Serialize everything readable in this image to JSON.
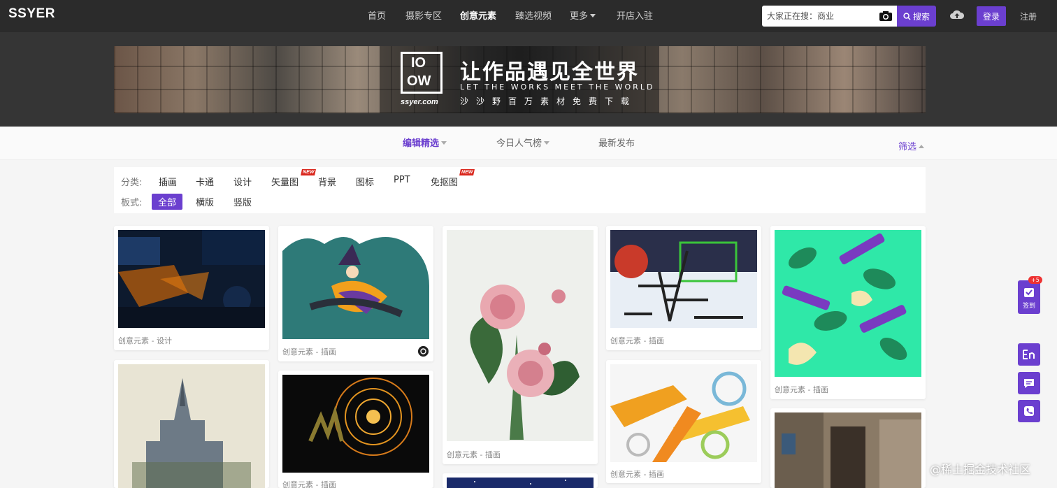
{
  "header": {
    "logo": "SSYER",
    "nav": [
      {
        "label": "首页"
      },
      {
        "label": "摄影专区"
      },
      {
        "label": "创意元素"
      },
      {
        "label": "臻选视频"
      },
      {
        "label": "更多"
      },
      {
        "label": "开店入驻"
      }
    ],
    "active_nav": "创意元素",
    "search_placeholder": "大家正在搜：商业",
    "search_button": "搜索",
    "login": "登录",
    "register": "注册"
  },
  "banner": {
    "logo_top": "IO",
    "logo_bottom": "OW",
    "site": "ssyer.com",
    "title": "让作品遇见全世界",
    "subtitle": "LET THE WORKS MEET THE WORLD",
    "subtitle_cn": "沙沙野百万素材免费下载"
  },
  "sort_tabs": [
    {
      "label": "编辑精选"
    },
    {
      "label": "今日人气榜"
    },
    {
      "label": "最新发布"
    }
  ],
  "filter_toggle": "筛选",
  "filters": {
    "category_label": "分类:",
    "categories": [
      "插画",
      "卡通",
      "设计",
      "矢量图",
      "背景",
      "图标",
      "PPT",
      "免抠图"
    ],
    "new_badge": "NEW",
    "layout_label": "板式:",
    "layouts": [
      "全部",
      "横版",
      "竖版"
    ]
  },
  "cards": [
    {
      "caption": "创意元素 - 设计"
    },
    {
      "caption": "创意元素 - 插画"
    },
    {
      "caption": "创意元素 - 插画"
    },
    {
      "caption": "创意元素 - 插画"
    },
    {
      "caption": "创意元素 - 插画"
    },
    {
      "caption": "创意元素 - 插画"
    },
    {
      "caption": "创意元素 - 插画"
    }
  ],
  "sidebar_tools": {
    "checkin_label": "签到",
    "checkin_bonus": "+5"
  },
  "watermark": "@稀土掘金技术社区",
  "colors": {
    "accent": "#6b3fcf",
    "topbar": "#2b2b2b"
  }
}
